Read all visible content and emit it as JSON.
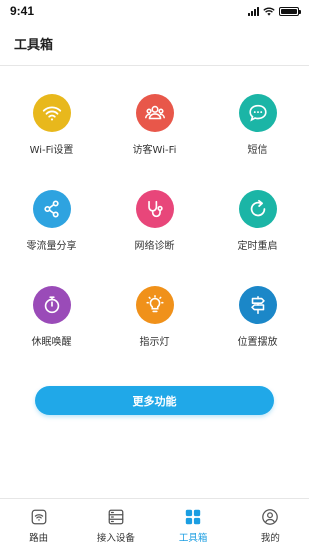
{
  "status_bar": {
    "time": "9:41"
  },
  "header": {
    "title": "工具箱"
  },
  "tools": [
    {
      "label": "Wi-Fi设置",
      "icon": "wifi-icon",
      "color": "#e8b81c"
    },
    {
      "label": "访客Wi-Fi",
      "icon": "guests-icon",
      "color": "#e8574a"
    },
    {
      "label": "短信",
      "icon": "message-icon",
      "color": "#1bb5a6"
    },
    {
      "label": "零流量分享",
      "icon": "share-icon",
      "color": "#2ea3e0"
    },
    {
      "label": "网络诊断",
      "icon": "stethoscope-icon",
      "color": "#e8467a"
    },
    {
      "label": "定时重启",
      "icon": "restart-icon",
      "color": "#1bb5a6"
    },
    {
      "label": "休眠唤醒",
      "icon": "timer-icon",
      "color": "#9a4bb8"
    },
    {
      "label": "指示灯",
      "icon": "bulb-icon",
      "color": "#f0911a"
    },
    {
      "label": "位置摆放",
      "icon": "signpost-icon",
      "color": "#1b87c8"
    }
  ],
  "more_button": {
    "label": "更多功能"
  },
  "tabbar": {
    "items": [
      {
        "label": "路由",
        "icon": "router-icon",
        "active": false
      },
      {
        "label": "接入设备",
        "icon": "devices-icon",
        "active": false
      },
      {
        "label": "工具箱",
        "icon": "toolbox-icon",
        "active": true
      },
      {
        "label": "我的",
        "icon": "profile-icon",
        "active": false
      }
    ],
    "active_color": "#1b9ee2"
  }
}
